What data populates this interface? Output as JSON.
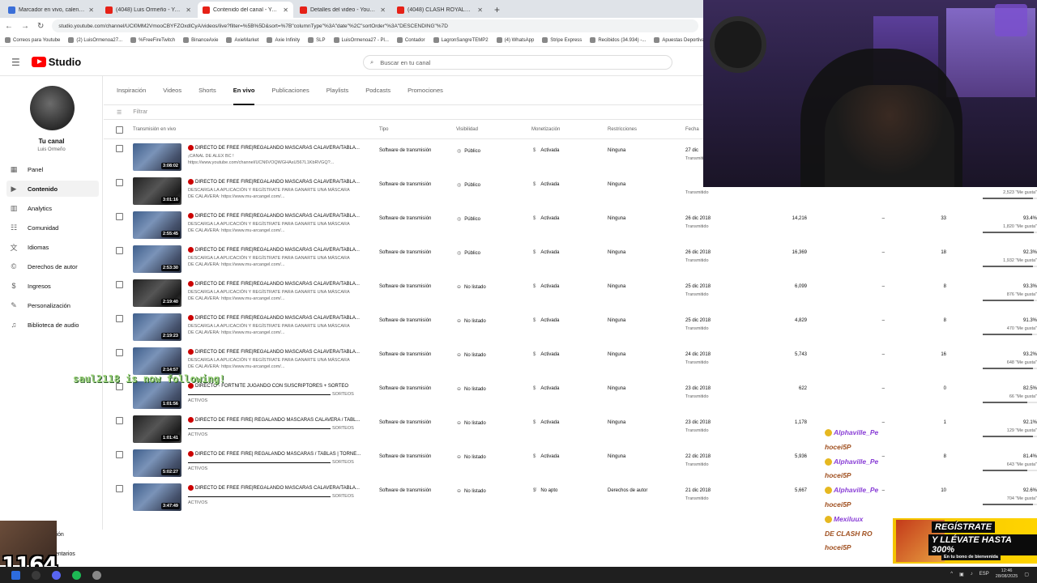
{
  "browser": {
    "tabs": [
      {
        "title": "Marcador en vivo, calendario y",
        "icon": "calendar-icon",
        "active": false
      },
      {
        "title": "(4048) Luis Ormeño - YouTube",
        "icon": "youtube-icon",
        "active": false
      },
      {
        "title": "Contenido del canal - YouTube",
        "icon": "youtube-icon",
        "active": true
      },
      {
        "title": "Detalles del video - YouTube St",
        "icon": "youtube-icon",
        "active": false
      },
      {
        "title": "(4048) CLASH ROYALE || LIGA",
        "icon": "youtube-icon",
        "active": false
      }
    ],
    "new_tab": "+",
    "url": "studio.youtube.com/channel/UCl0MM2VmooCBYFZOxdlCyA/videos/live?filter=%5B%5D&sort=%7B\"columnType\"%3A\"date\"%2C\"sortOrder\"%3A\"DESCENDING\"%7D",
    "bookmarks": [
      "Correos para Youtube",
      "(2) LuisOrmenoa27...",
      "%FreeFireTwitch",
      "BinanceAxie",
      "AxieMarket",
      "Axie Infinity",
      "SLP",
      "LuisOrmenoa27 - Pl...",
      "Contador",
      "LagronSangreTEMP2",
      "(4) WhatsApp",
      "Stripe Express",
      "Recibidos (34.934) -...",
      "Apuestas Deportiva"
    ]
  },
  "header": {
    "logo_text": "Studio",
    "search_placeholder": "Buscar en tu canal"
  },
  "sidebar": {
    "channel_name": "Tu canal",
    "channel_sub": "Luis Ormeño",
    "items": [
      {
        "label": "Panel",
        "icon": "dashboard-icon"
      },
      {
        "label": "Contenido",
        "icon": "content-icon",
        "active": true
      },
      {
        "label": "Analytics",
        "icon": "analytics-icon"
      },
      {
        "label": "Comunidad",
        "icon": "community-icon"
      },
      {
        "label": "Idiomas",
        "icon": "languages-icon"
      },
      {
        "label": "Derechos de autor",
        "icon": "copyright-icon"
      },
      {
        "label": "Ingresos",
        "icon": "earn-icon"
      },
      {
        "label": "Personalización",
        "icon": "customization-icon"
      },
      {
        "label": "Biblioteca de audio",
        "icon": "audio-library-icon"
      }
    ],
    "bottom_items": [
      "ación",
      "mentarios"
    ]
  },
  "content_tabs": [
    {
      "label": "Inspiración"
    },
    {
      "label": "Videos"
    },
    {
      "label": "Shorts"
    },
    {
      "label": "En vivo",
      "active": true
    },
    {
      "label": "Publicaciones"
    },
    {
      "label": "Playlists"
    },
    {
      "label": "Podcasts"
    },
    {
      "label": "Promociones"
    }
  ],
  "filter": {
    "placeholder": "Filtrar"
  },
  "table": {
    "headers": {
      "video": "Transmisión en vivo",
      "tipo": "Tipo",
      "visibilidad": "Visibilidad",
      "monetizacion": "Monetización",
      "restricciones": "Restricciones",
      "fecha": "Fecha"
    },
    "rows": [
      {
        "duration": "3:08:02",
        "title": "DIRECTO DE FREE FIRE|REGALANDO MASCARAS CALAVERA/TABLA...",
        "desc1": "¡CANAL DE ALEX BC !",
        "desc2": "https://www.youtube.com/channel/UCN6VOQWGHAsU567L1KbRVGQ?...",
        "tipo": "Software de transmisión",
        "visibility": "Público",
        "vis_icon": "globe-icon",
        "monet": "Activada",
        "restr": "Ninguna",
        "date": "27 dic",
        "date_sub": "Transmitido",
        "views": "",
        "comments": "",
        "dash": "",
        "likes_pct": "",
        "likes": "",
        "like_fill": 0,
        "dark": false
      },
      {
        "duration": "3:01:16",
        "title": "DIRECTO DE FREE FIRE|REGALANDO MASCARAS CALAVERA/TABLA...",
        "desc1": "DESCARGA LA APLICACIÓN Y REGÍSTRATE PARA GANARTE UNA MÁSCARA",
        "desc2": "DE CALAVERA: https://www.mu-arcangel.com/...",
        "tipo": "Software de transmisión",
        "visibility": "Público",
        "vis_icon": "globe-icon",
        "monet": "Activada",
        "restr": "Ninguna",
        "date": "",
        "date_sub": "Transmitido",
        "views": "",
        "comments": "",
        "dash": "",
        "likes_pct": "",
        "likes": "2,523 \"Me gusta\"",
        "like_fill": 0.93,
        "dark": true
      },
      {
        "duration": "2:55:45",
        "title": "DIRECTO DE FREE FIRE|REGALANDO MASCARAS CALAVERA/TABLA...",
        "desc1": "DESCARGA LA APLICACIÓN Y REGÍSTRATE PARA GANARTE UNA MÁSCARA",
        "desc2": "DE CALAVERA: https://www.mu-arcangel.com/...",
        "tipo": "Software de transmisión",
        "visibility": "Público",
        "vis_icon": "globe-icon",
        "monet": "Activada",
        "restr": "Ninguna",
        "date": "26 dic 2018",
        "date_sub": "Transmitido",
        "views": "14,216",
        "dash": "–",
        "comments": "33",
        "likes_pct": "93.4%",
        "likes": "1,820 \"Me gusta\"",
        "like_fill": 0.934,
        "dark": false
      },
      {
        "duration": "2:53:30",
        "title": "DIRECTO DE FREE FIRE|REGALANDO MASCARAS CALAVERA/TABLA...",
        "desc1": "DESCARGA LA APLICACIÓN Y REGÍSTRATE PARA GANARTE UNA MÁSCARA",
        "desc2": "DE CALAVERA: https://www.mu-arcangel.com/...",
        "tipo": "Software de transmisión",
        "visibility": "Público",
        "vis_icon": "globe-icon",
        "monet": "Activada",
        "restr": "Ninguna",
        "date": "26 dic 2018",
        "date_sub": "Transmitido",
        "views": "16,369",
        "dash": "–",
        "comments": "18",
        "likes_pct": "92.3%",
        "likes": "1,932 \"Me gusta\"",
        "like_fill": 0.923,
        "dark": false
      },
      {
        "duration": "2:19:40",
        "title": "DIRECTO DE FREE FIRE|REGALANDO MASCARAS CALAVERA/TABLA...",
        "desc1": "DESCARGA LA APLICACIÓN Y REGÍSTRATE PARA GANARTE UNA MÁSCARA",
        "desc2": "DE CALAVERA: https://www.mu-arcangel.com/...",
        "tipo": "Software de transmisión",
        "visibility": "No listado",
        "vis_icon": "unlisted-icon",
        "monet": "Activada",
        "restr": "Ninguna",
        "date": "25 dic 2018",
        "date_sub": "Transmitido",
        "views": "6,099",
        "dash": "–",
        "comments": "8",
        "likes_pct": "93.3%",
        "likes": "876 \"Me gusta\"",
        "like_fill": 0.933,
        "dark": true
      },
      {
        "duration": "2:19:23",
        "title": "DIRECTO DE FREE FIRE|REGALANDO MASCARAS CALAVERA/TABLA...",
        "desc1": "DESCARGA LA APLICACIÓN Y REGÍSTRATE PARA GANARTE UNA MÁSCARA",
        "desc2": "DE CALAVERA: https://www.mu-arcangel.com/...",
        "tipo": "Software de transmisión",
        "visibility": "No listado",
        "vis_icon": "unlisted-icon",
        "monet": "Activada",
        "restr": "Ninguna",
        "date": "25 dic 2018",
        "date_sub": "Transmitido",
        "views": "4,829",
        "dash": "–",
        "comments": "8",
        "likes_pct": "91.3%",
        "likes": "470 \"Me gusta\"",
        "like_fill": 0.913,
        "dark": false
      },
      {
        "duration": "2:14:57",
        "title": "DIRECTO DE FREE FIRE|REGALANDO MASCARAS CALAVERA/TABLA...",
        "desc1": "DESCARGA LA APLICACIÓN Y REGÍSTRATE PARA GANARTE UNA MÁSCARA",
        "desc2": "DE CALAVERA: https://www.mu-arcangel.com/...",
        "tipo": "Software de transmisión",
        "visibility": "No listado",
        "vis_icon": "unlisted-icon",
        "monet": "Activada",
        "restr": "Ninguna",
        "date": "24 dic 2018",
        "date_sub": "Transmitido",
        "views": "5,743",
        "dash": "–",
        "comments": "16",
        "likes_pct": "93.2%",
        "likes": "648 \"Me gusta\"",
        "like_fill": 0.932,
        "dark": false
      },
      {
        "duration": "1:01:56",
        "title": "DIRECTO - FORTNITE  JUGANDO CON SUSCRIPTORES + SORTEO",
        "desc1": "SORTEOS",
        "desc2": "ACTIVOS",
        "tipo": "Software de transmisión",
        "visibility": "No listado",
        "vis_icon": "unlisted-icon",
        "monet": "Activada",
        "restr": "Ninguna",
        "date": "23 dic 2018",
        "date_sub": "Transmitido",
        "views": "622",
        "dash": "–",
        "comments": "0",
        "likes_pct": "82.5%",
        "likes": "66 \"Me gusta\"",
        "like_fill": 0.825,
        "dark": false,
        "bar": true
      },
      {
        "duration": "1:01:41",
        "title": "DIRECTO DE FREE FIRE| REGALANDO MÁSCARAS CALAVERA / TABL...",
        "desc1": "SORTEOS",
        "desc2": "ACTIVOS",
        "tipo": "Software de transmisión",
        "visibility": "No listado",
        "vis_icon": "unlisted-icon",
        "monet": "Activada",
        "restr": "Ninguna",
        "date": "23 dic 2018",
        "date_sub": "Transmitido",
        "views": "1,178",
        "dash": "–",
        "comments": "1",
        "likes_pct": "92.1%",
        "likes": "129 \"Me gusta\"",
        "like_fill": 0.921,
        "dark": true,
        "bar": true
      },
      {
        "duration": "5:02:27",
        "title": "DIRECTO DE FREE FIRE| REGALANDO MÁSCARAS / TABLAS | TORNE...",
        "desc1": "SORTEOS",
        "desc2": "ACTIVOS",
        "tipo": "Software de transmisión",
        "visibility": "No listado",
        "vis_icon": "unlisted-icon",
        "monet": "Activada",
        "restr": "Ninguna",
        "date": "22 dic 2018",
        "date_sub": "Transmitido",
        "views": "5,936",
        "dash": "–",
        "comments": "8",
        "likes_pct": "81.4%",
        "likes": "643 \"Me gusta\"",
        "like_fill": 0.814,
        "dark": false,
        "bar": true
      },
      {
        "duration": "3:47:49",
        "title": "DIRECTO DE FREE FIRE|REGALANDO MASCARAS CALAVERA/TABLA...",
        "desc1": "SORTEOS",
        "desc2": "ACTIVOS",
        "tipo": "Software de transmisión",
        "visibility": "No listado",
        "vis_icon": "unlisted-icon",
        "monet": "No apto",
        "restr": "Derechos de autor",
        "date": "21 dic 2018",
        "date_sub": "Transmitido",
        "views": "5,667",
        "dash": "–",
        "comments": "10",
        "likes_pct": "92.6%",
        "likes": "704 \"Me gusta\"",
        "like_fill": 0.926,
        "dark": false,
        "bar": true
      }
    ]
  },
  "overlays": {
    "follow_text": "saul2118 is now following!",
    "chat": [
      {
        "user": "Alphaville_Pe",
        "style": "p"
      },
      {
        "user": "hocei5P",
        "style": "o"
      },
      {
        "user": "Alphaville_Pe",
        "style": "p"
      },
      {
        "user": "hocei5P",
        "style": "o"
      },
      {
        "user": "Alphaville_Pe",
        "style": "p"
      },
      {
        "user": "hocei5P",
        "style": "o"
      },
      {
        "user": "Mexiluux",
        "style": "p"
      },
      {
        "user": "DE CLASH RO",
        "style": "o"
      },
      {
        "user": "hocei5P",
        "style": "o"
      }
    ],
    "ad": {
      "line1": "REGÍSTRATE",
      "line2": "Y LLÉVATE HASTA 300%",
      "line3": "En tu bono de bienvenida"
    },
    "sub_count": "1164"
  },
  "taskbar": {
    "lang": "ESP",
    "time": "12:46",
    "date": "28/08/2025"
  }
}
